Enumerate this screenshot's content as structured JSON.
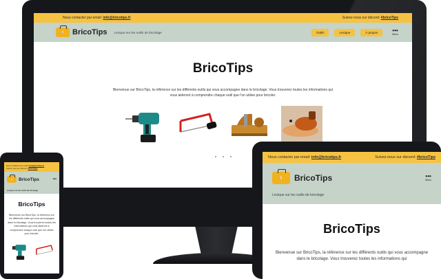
{
  "site": {
    "brand": "BricoTips",
    "tagline": "Lexique sur les outils de bricolage",
    "contact_prefix": "Nous contacter par email:",
    "contact_email": "info@bricotips.fr",
    "discord_prefix": "Suivez-nous sur discord:",
    "discord_handle": "#bricoTips",
    "menu_label": "Menu",
    "nav": [
      "Outils",
      "Lexique",
      "À propos"
    ],
    "title": "BricoTips",
    "intro": "Bienvenue sur BricoTips, la référence sur les différents outils qui vous accompagne dans le bricolage. Vous trouverez toutes les informations qui vous aideront à comprendre chaque outil que l'on utilise pour bricoler.",
    "tablet_intro_visible": "Bienvenue sur BricoTips, la référence sur les différents outils qui vous accompagne dans le bricolage. Vous trouverez toutes les informations qui"
  },
  "icons": {
    "logo": "toolbox-icon",
    "menu": "more-horizontal-icon",
    "tools": [
      "drill-icon",
      "hacksaw-icon",
      "wood-plane-icon",
      "sander-icon"
    ]
  },
  "colors": {
    "topbar": "#f5c242",
    "navbar": "#c5d3c9",
    "button": "#f5c242",
    "device_frame": "#16171a"
  }
}
